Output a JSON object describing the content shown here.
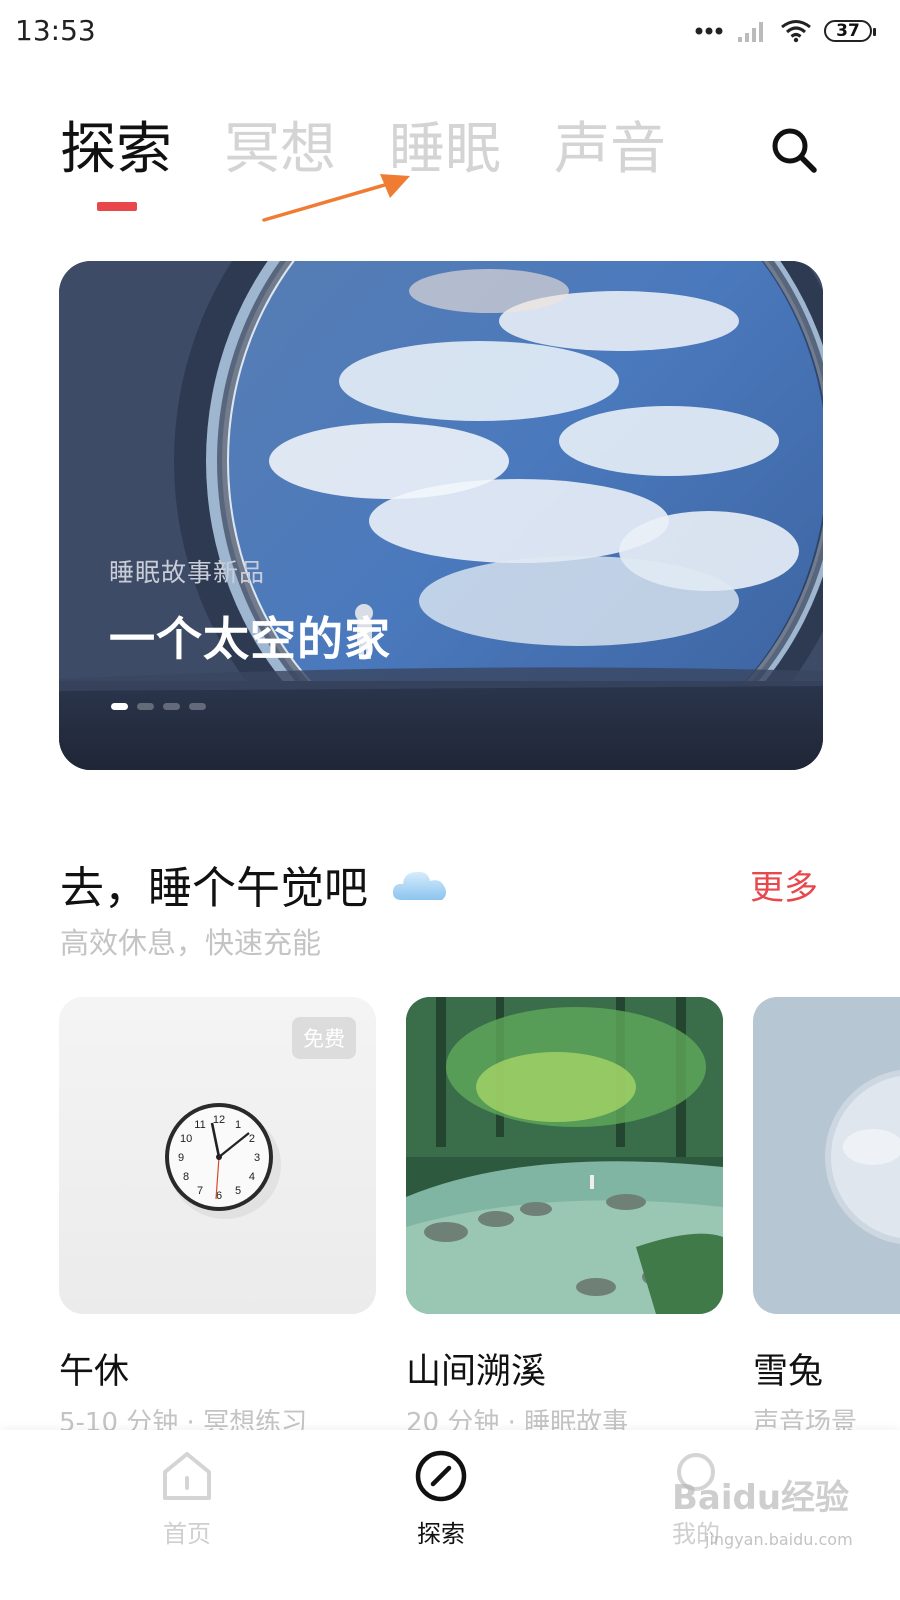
{
  "status_bar": {
    "time": "13:53",
    "battery": "37"
  },
  "tabs": [
    {
      "label": "探索",
      "active": true
    },
    {
      "label": "冥想",
      "active": false
    },
    {
      "label": "睡眠",
      "active": false
    },
    {
      "label": "声音",
      "active": false
    }
  ],
  "accent_color": "#e8474c",
  "banner": {
    "subtitle": "睡眠故事新品",
    "title": "一个太空的家",
    "page_count": 4,
    "active_page": 1
  },
  "section": {
    "title": "去，睡个午觉吧",
    "subtitle": "高效休息，快速充能",
    "more": "更多"
  },
  "cards": [
    {
      "title": "午休",
      "meta": "5-10 分钟 · 冥想练习",
      "badge": "免费",
      "image": "wall-clock"
    },
    {
      "title": "山间溯溪",
      "meta": "20 分钟 · 睡眠故事",
      "image": "forest-stream"
    },
    {
      "title": "雪兔",
      "meta": "声音场景",
      "image": "snow-moon"
    }
  ],
  "clock_numbers": [
    "12",
    "1",
    "2",
    "3",
    "4",
    "5",
    "6",
    "7",
    "8",
    "9",
    "10",
    "11"
  ],
  "bottom_nav": [
    {
      "label": "首页",
      "icon": "home-icon",
      "active": false
    },
    {
      "label": "探索",
      "icon": "compass-icon",
      "active": true
    },
    {
      "label": "我的",
      "icon": "profile-icon",
      "active": false
    }
  ],
  "watermark": {
    "text": "Baidu经验",
    "url": "jingyan.baidu.com"
  }
}
